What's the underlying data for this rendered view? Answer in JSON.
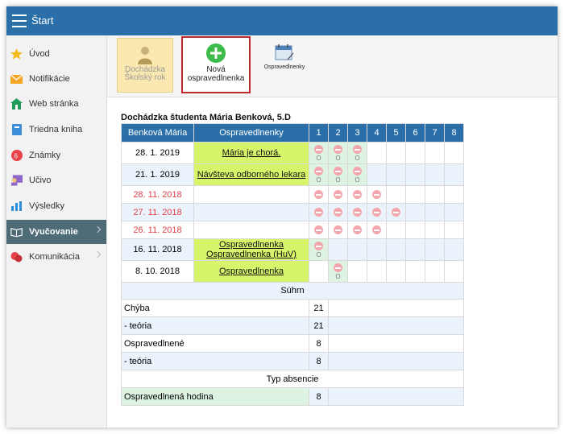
{
  "topbar": {
    "title": "Štart"
  },
  "sidebar": {
    "items": [
      {
        "label": "Úvod",
        "icon": "star-icon"
      },
      {
        "label": "Notifikácie",
        "icon": "mail-icon"
      },
      {
        "label": "Web stránka",
        "icon": "home-icon"
      },
      {
        "label": "Triedna kniha",
        "icon": "book-icon"
      },
      {
        "label": "Známky",
        "icon": "grades-icon"
      },
      {
        "label": "Učivo",
        "icon": "teacher-icon"
      },
      {
        "label": "Výsledky",
        "icon": "bar-chart-icon"
      },
      {
        "label": "Vyučovanie",
        "icon": "open-book-icon"
      },
      {
        "label": "Komunikácia",
        "icon": "chat-icon"
      }
    ]
  },
  "toolbar": {
    "attendance_label": "Dochádzka Školský rok",
    "new_excuse_label": "Nová ospravedlnenka",
    "excuses_label": "Ospravedlnenky"
  },
  "page": {
    "heading": "Dochádzka študenta Mária Benková, 5.D",
    "col_student": "Benková Mária",
    "col_excuses": "Ospravedlnenky",
    "hours": [
      "1",
      "2",
      "3",
      "4",
      "5",
      "6",
      "7",
      "8"
    ]
  },
  "rows": [
    {
      "date": "28. 1. 2019",
      "excuse": "Mária je chorá.",
      "excuse2": ""
    },
    {
      "date": "21. 1. 2019",
      "excuse": "Návšteva odborného lekara",
      "excuse2": ""
    },
    {
      "date": "28. 11. 2018",
      "excuse": "",
      "excuse2": ""
    },
    {
      "date": "27. 11. 2018",
      "excuse": "",
      "excuse2": ""
    },
    {
      "date": "26. 11. 2018",
      "excuse": "",
      "excuse2": ""
    },
    {
      "date": "16. 11. 2018",
      "excuse": "Ospravedlnenka",
      "excuse2": "Ospravedlnenka (HuV)"
    },
    {
      "date": "8. 10. 2018",
      "excuse": "Ospravedlnenka",
      "excuse2": ""
    }
  ],
  "marks": {
    "o": "O"
  },
  "summary": {
    "title": "Súhrn",
    "missing": "Chýba",
    "missing_val": "21",
    "theory": "- teória",
    "missing_theory_val": "21",
    "excused": "Ospravedlnené",
    "excused_val": "8",
    "excused_theory_val": "8",
    "type_title": "Typ absencie",
    "type_label": "Ospravedlnená hodina",
    "type_val": "8"
  }
}
